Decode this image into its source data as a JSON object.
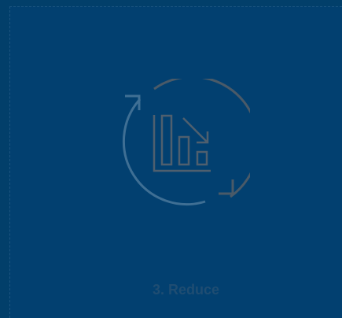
{
  "step": {
    "label": "3. Reduce",
    "icon": "reduce-cycle-chart-icon"
  },
  "colors": {
    "background": "#023f6a",
    "arrow_blue": "#3f6f94",
    "arrow_gray": "#4a5a68",
    "chart_gray": "#4f5f6e",
    "caption": "#1f4d72"
  }
}
